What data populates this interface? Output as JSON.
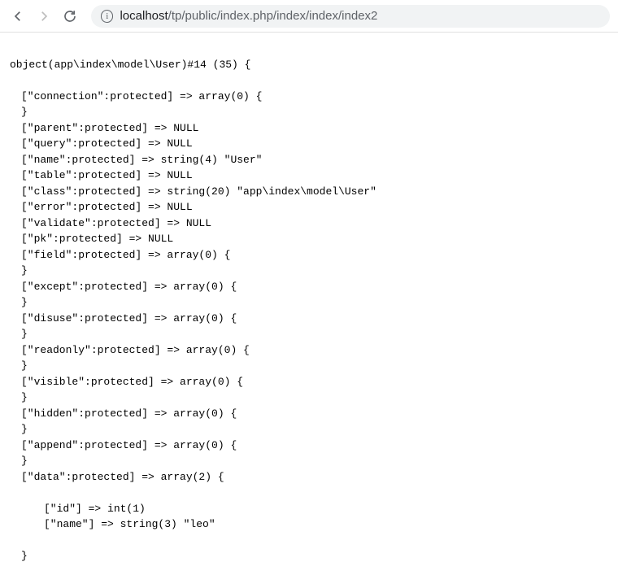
{
  "toolbar": {
    "url_host": "localhost",
    "url_path": "/tp/public/index.php/index/index/index2"
  },
  "dump": {
    "header": "object(app\\index\\model\\User)#14 (35) {",
    "lines": [
      "[\"connection\":protected] => array(0) {",
      "}",
      "[\"parent\":protected] => NULL",
      "[\"query\":protected] => NULL",
      "[\"name\":protected] => string(4) \"User\"",
      "[\"table\":protected] => NULL",
      "[\"class\":protected] => string(20) \"app\\index\\model\\User\"",
      "[\"error\":protected] => NULL",
      "[\"validate\":protected] => NULL",
      "[\"pk\":protected] => NULL",
      "[\"field\":protected] => array(0) {",
      "}",
      "[\"except\":protected] => array(0) {",
      "}",
      "[\"disuse\":protected] => array(0) {",
      "}",
      "[\"readonly\":protected] => array(0) {",
      "}",
      "[\"visible\":protected] => array(0) {",
      "}",
      "[\"hidden\":protected] => array(0) {",
      "}",
      "[\"append\":protected] => array(0) {",
      "}",
      "[\"data\":protected] => array(2) {"
    ],
    "data_inner": [
      "[\"id\"] => int(1)",
      "[\"name\"] => string(3) \"leo\""
    ],
    "data_close": "}"
  }
}
